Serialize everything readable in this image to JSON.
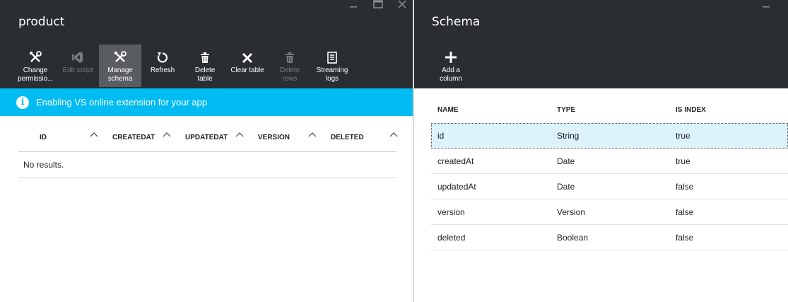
{
  "left_blade": {
    "title": "product",
    "window_controls": [
      "minimize",
      "maximize",
      "close"
    ],
    "commands": [
      {
        "id": "change-permissions",
        "label_line1": "Change",
        "label_line2": "permissio...",
        "icon": "tools-icon",
        "state": "normal"
      },
      {
        "id": "edit-script",
        "label_line1": "Edit script",
        "label_line2": "",
        "icon": "visual-studio-icon",
        "state": "disabled"
      },
      {
        "id": "manage-schema",
        "label_line1": "Manage",
        "label_line2": "schema",
        "icon": "tools-icon",
        "state": "active"
      },
      {
        "id": "refresh",
        "label_line1": "Refresh",
        "label_line2": "",
        "icon": "refresh-icon",
        "state": "normal"
      },
      {
        "id": "delete-table",
        "label_line1": "Delete",
        "label_line2": "table",
        "icon": "trash-icon",
        "state": "normal"
      },
      {
        "id": "clear-table",
        "label_line1": "Clear table",
        "label_line2": "",
        "icon": "x-icon",
        "state": "normal"
      },
      {
        "id": "delete-rows",
        "label_line1": "Delete",
        "label_line2": "rows",
        "icon": "trash-icon",
        "state": "disabled"
      },
      {
        "id": "streaming-logs",
        "label_line1": "Streaming",
        "label_line2": "logs",
        "icon": "log-icon",
        "state": "normal"
      }
    ],
    "notification": {
      "text": "Enabling VS online extension for your app",
      "icon": "info-icon",
      "color": "#00bcf2"
    },
    "grid": {
      "columns": [
        "ID",
        "CREATEDAT",
        "UPDATEDAT",
        "VERSION",
        "DELETED"
      ],
      "empty_text": "No results."
    }
  },
  "right_blade": {
    "title": "Schema",
    "window_controls": [
      "minimize"
    ],
    "commands": [
      {
        "id": "add-column",
        "label_line1": "Add a",
        "label_line2": "column",
        "icon": "plus-icon",
        "state": "normal"
      }
    ],
    "table": {
      "headers": [
        "NAME",
        "TYPE",
        "IS INDEX"
      ],
      "rows": [
        {
          "name": "id",
          "type": "String",
          "is_index": "true",
          "selected": true
        },
        {
          "name": "createdAt",
          "type": "Date",
          "is_index": "true",
          "selected": false
        },
        {
          "name": "updatedAt",
          "type": "Date",
          "is_index": "false",
          "selected": false
        },
        {
          "name": "version",
          "type": "Version",
          "is_index": "false",
          "selected": false
        },
        {
          "name": "deleted",
          "type": "Boolean",
          "is_index": "false",
          "selected": false
        }
      ]
    }
  },
  "colors": {
    "header_bg": "#2a2e33",
    "active_command_bg": "#595d62",
    "selected_row_bg": "#dcf3fb",
    "accent": "#00bcf2"
  }
}
